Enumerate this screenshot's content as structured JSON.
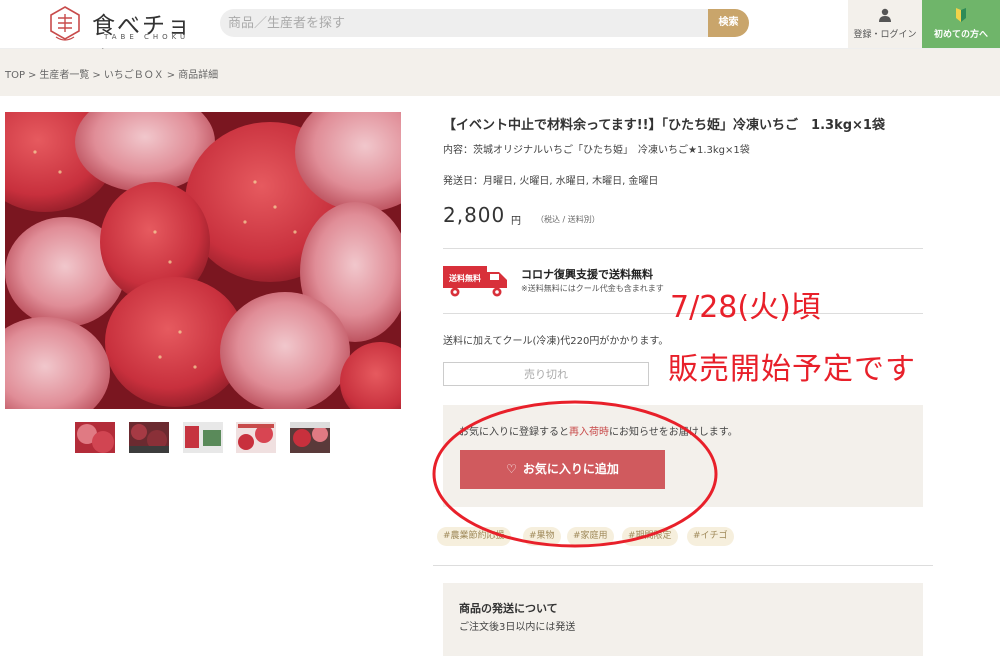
{
  "header": {
    "logo_text": "食べチョク",
    "logo_sub": "TABE CHOKU",
    "search_placeholder": "商品／生産者を探す",
    "search_button": "検索",
    "login_label": "登録・ログイン",
    "first_time_label": "初めての方へ"
  },
  "breadcrumb": [
    "TOP",
    "生産者一覧",
    "いちごＢＯＸ",
    "商品詳細"
  ],
  "product": {
    "title": "【イベント中止で材料余ってます!!】「ひたち姫」冷凍いちご　1.3kg×1袋",
    "content": "内容：茨城オリジナルいちご「ひたち姫」　冷凍いちご★1.3kg×1袋",
    "ship_days": "発送日：月曜日, 火曜日, 水曜日, 木曜日, 金曜日",
    "price": "2,800",
    "price_unit": "円",
    "price_note": "（税込 / 送料別）",
    "truck_label": "送料無料",
    "promo_title": "コロナ復興支援で送料無料",
    "promo_note": "※送料無料にはクール代金も含まれます",
    "cool_note": "送料に加えてクール(冷凍)代220円がかかります。",
    "soldout_label": "売り切れ",
    "fav_text_before": "お気に入りに登録すると",
    "fav_text_highlight": "再入荷時",
    "fav_text_after": "にお知らせをお届けします。",
    "fav_button": "お気に入りに追加",
    "tags": [
      "#農業節約応援",
      "#果物",
      "#家庭用",
      "#期間限定",
      "#イチゴ"
    ],
    "ship_box_title": "商品の発送について",
    "ship_box_text": "ご注文後3日以内には発送"
  },
  "annotation": {
    "date": "7/28(火)頃",
    "sale": "販売開始予定です",
    "color": "#e8202a"
  },
  "colors": {
    "accent_gold": "#c9a56b",
    "green": "#6fb56a",
    "fav_red": "#d05a5e",
    "panel_beige": "#f3f0eb"
  }
}
